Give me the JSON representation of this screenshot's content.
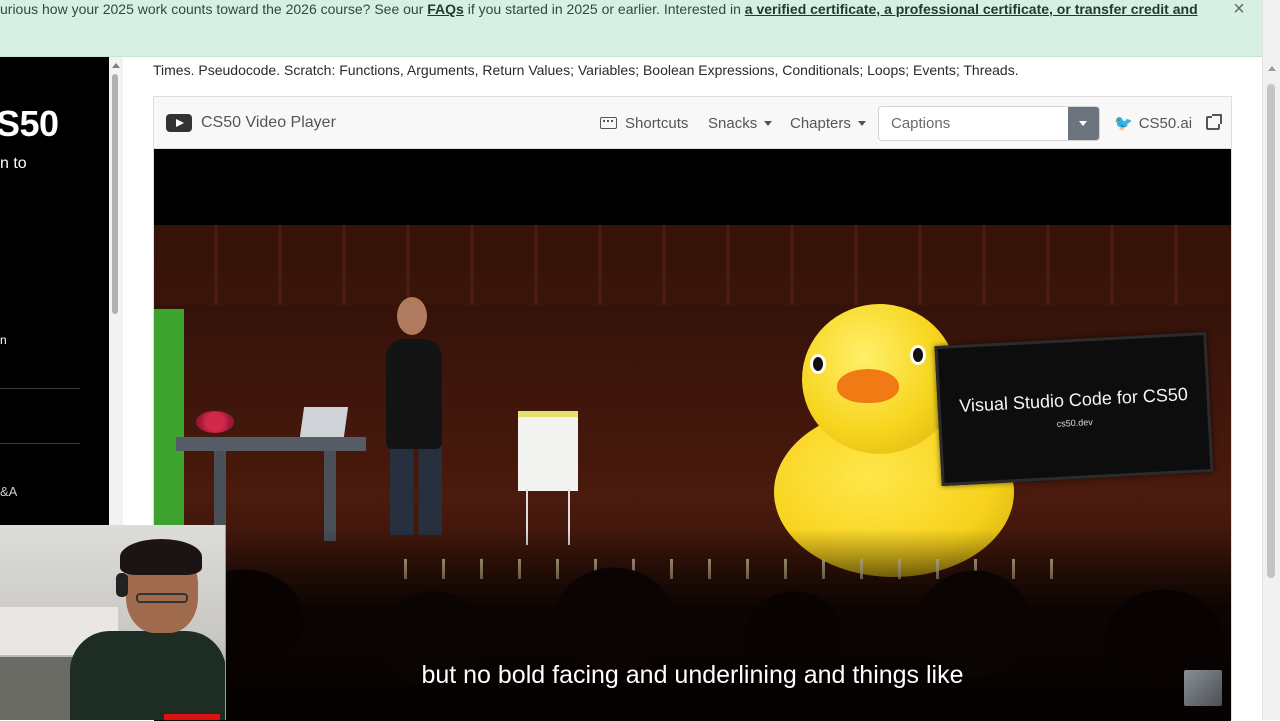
{
  "banner": {
    "text_part1": "urious how your 2025 work counts toward the 2026 course? See our ",
    "faqs_link": "FAQs",
    "text_part2": " if you started in 2025 or earlier. Interested in ",
    "cert_link": "a verified certificate, a professional certificate, or transfer credit and",
    "close_icon": "×"
  },
  "sidebar": {
    "logo": "S50",
    "subtitle": "n to",
    "mark": "n",
    "qa_label": "&A"
  },
  "description": "Times. Pseudocode. Scratch: Functions, Arguments, Return Values; Variables; Boolean Expressions, Conditionals; Loops; Events; Threads.",
  "player": {
    "title": "CS50 Video Player",
    "shortcuts": "Shortcuts",
    "snacks": "Snacks",
    "chapters": "Chapters",
    "captions_placeholder": "Captions",
    "cs50ai": "CS50.ai",
    "subtitle": "but no bold facing and underlining and things like",
    "tv_title": "Visual Studio Code for CS50",
    "tv_sub": "cs50.dev"
  },
  "icons": {
    "youtube": "youtube-icon",
    "keyboard": "keyboard-icon",
    "duck": "duck-icon",
    "external": "external-link-icon"
  }
}
